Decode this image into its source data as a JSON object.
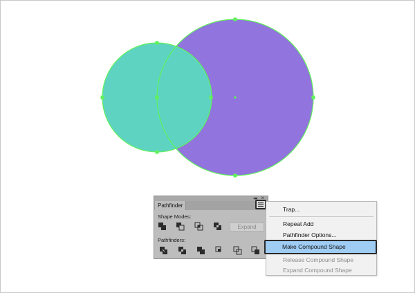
{
  "panel": {
    "tab_label": "Pathfinder",
    "close_glyph": "×",
    "grip_glyph": "◂◂",
    "shape_modes_label": "Shape Modes:",
    "pathfinders_label": "Pathfinders:",
    "expand_label": "Expand",
    "shape_mode_icons": [
      "unite-icon",
      "minus-front-icon",
      "intersect-icon",
      "exclude-icon"
    ],
    "pathfinder_icons": [
      "divide-icon",
      "trim-icon",
      "merge-icon",
      "crop-icon",
      "outline-icon",
      "minus-back-icon"
    ]
  },
  "flyout": {
    "items": [
      {
        "label": "Trap...",
        "enabled": true
      },
      {
        "label": "Repeat Add",
        "enabled": true
      },
      {
        "label": "Pathfinder Options...",
        "enabled": true
      },
      {
        "label": "Make Compound Shape",
        "enabled": true,
        "highlighted": true
      },
      {
        "label": "Release Compound Shape",
        "enabled": false
      },
      {
        "label": "Expand Compound Shape",
        "enabled": false
      }
    ]
  },
  "colors": {
    "teal_circle": "#5ed3c2",
    "purple_circle": "#9174dd",
    "selection_green": "#5ff25a",
    "highlight": "#9fccf3"
  }
}
